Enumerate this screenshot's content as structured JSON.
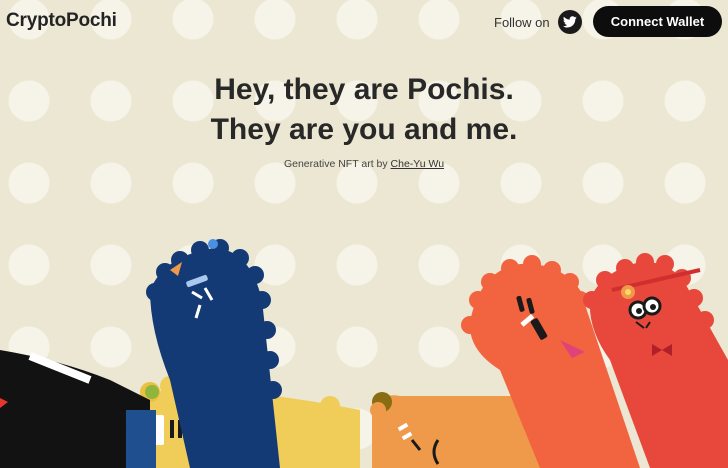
{
  "header": {
    "brand": "CryptoPochi",
    "follow_label": "Follow on",
    "connect_label": "Connect Wallet"
  },
  "hero": {
    "line1": "Hey, they are Pochis.",
    "line2": "They are you and me.",
    "credit_prefix": "Generative NFT art by",
    "author": "Che-Yu Wu"
  },
  "icons": {
    "social": "twitter-icon"
  },
  "colors": {
    "background": "#ebe7d3",
    "polka_dot": "#f6f3e8",
    "button": "#0d0d0d",
    "pochi_black": "#121212",
    "pochi_blue": "#143a75",
    "pochi_yellow": "#f0cc58",
    "pochi_orange": "#ef9a4b",
    "pochi_coral": "#f2633f",
    "pochi_red": "#e8483b"
  }
}
